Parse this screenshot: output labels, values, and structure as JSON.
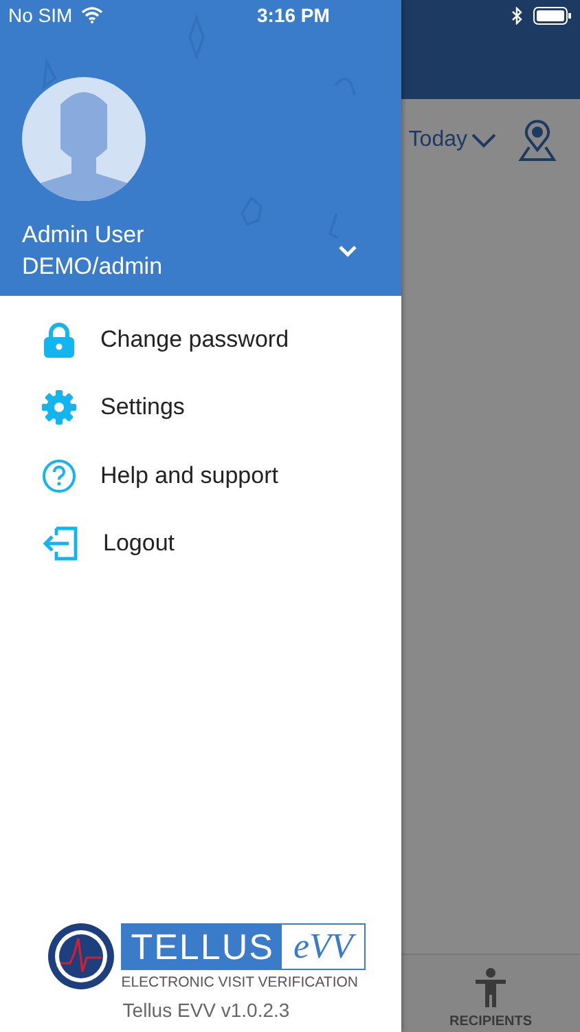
{
  "status_bar": {
    "carrier": "No SIM",
    "time": "3:16 PM"
  },
  "background_screen": {
    "date_filter": "Today",
    "tab_bar": [
      {
        "label": "RECIPIENTS"
      }
    ]
  },
  "drawer": {
    "user": {
      "name": "Admin User",
      "account": "DEMO/admin"
    },
    "menu": [
      {
        "label": "Change password"
      },
      {
        "label": "Settings"
      },
      {
        "label": "Help and support"
      },
      {
        "label": "Logout"
      }
    ],
    "footer": {
      "logo_brand": "TELLUS",
      "logo_mark": "eVV",
      "logo_tagline": "ELECTRONIC VISIT VERIFICATION",
      "version": "Tellus EVV v1.0.2.3"
    }
  }
}
